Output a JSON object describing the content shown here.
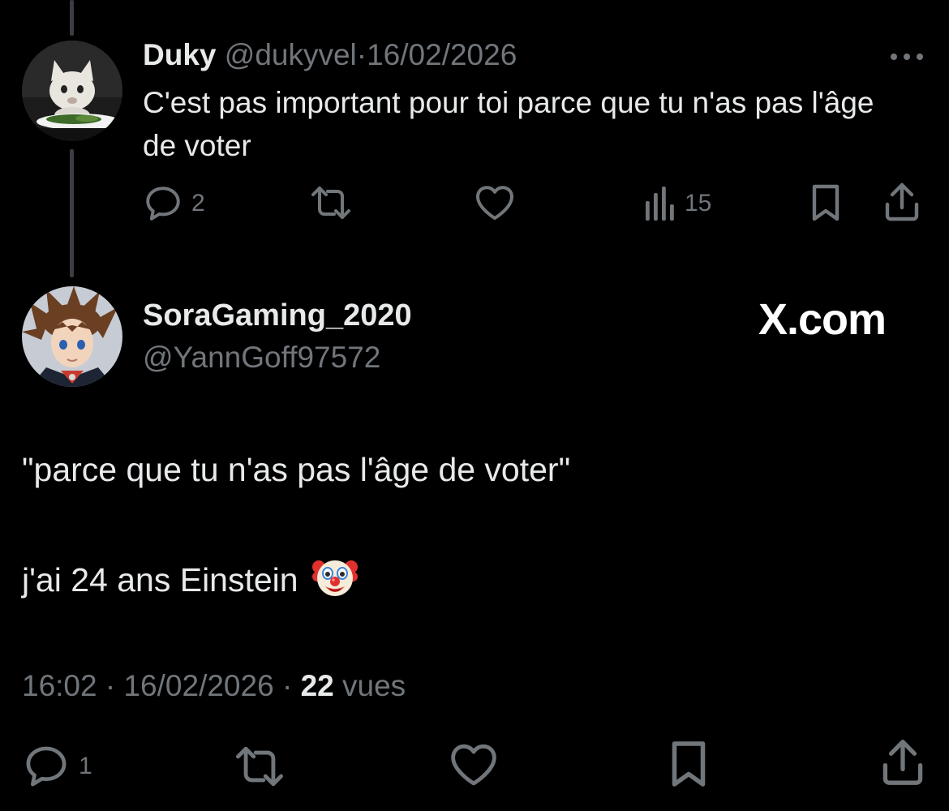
{
  "reply": {
    "author_name": "Duky",
    "author_handle": "@dukyvel",
    "separator": "·",
    "date": "16/02/2026",
    "text": "C'est pas important pour toi parce que tu n'as pas l'âge de voter",
    "actions": {
      "replies": "2",
      "views": "15"
    },
    "more_icon": "more-horizontal-icon"
  },
  "main_post": {
    "author_name": "SoraGaming_2020",
    "author_handle": "@YannGoff97572",
    "watermark": "X.com",
    "line1": "\"parce que tu n'as pas l'âge de voter\"",
    "line2": "j'ai 24 ans Einstein",
    "emoji": "clown-face-emoji",
    "time": "16:02",
    "separator": "·",
    "date": "16/02/2026",
    "views_count": "22",
    "views_label": "vues",
    "actions": {
      "replies": "1"
    }
  },
  "colors": {
    "background": "#000000",
    "text": "#e7e9ea",
    "muted": "#71767b",
    "thread_line": "#3a3d41"
  }
}
